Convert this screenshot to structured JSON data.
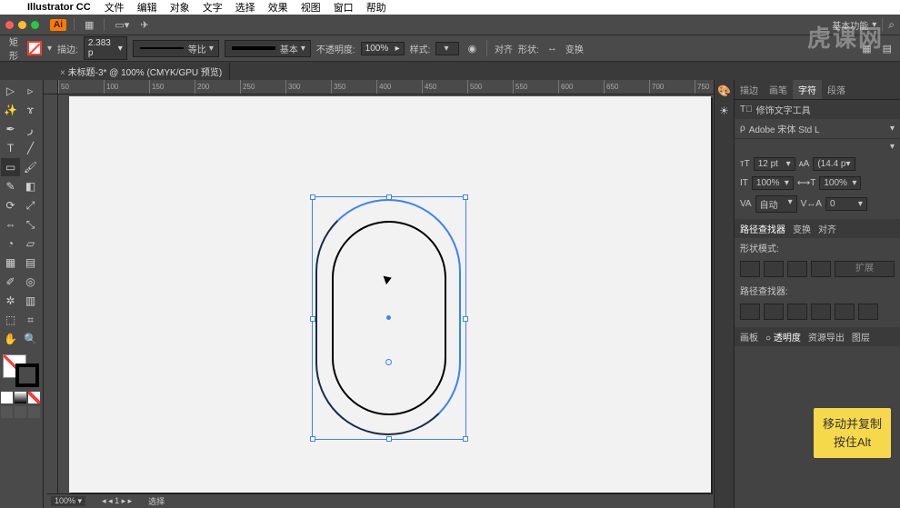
{
  "mac_menu": {
    "app_name": "Illustrator CC",
    "items": [
      "文件",
      "编辑",
      "对象",
      "文字",
      "选择",
      "效果",
      "视图",
      "窗口",
      "帮助"
    ]
  },
  "chrome": {
    "essentials_label": "基本功能",
    "search_icon": "search-icon"
  },
  "control_bar": {
    "tool_label": "矩形",
    "stroke_label": "描边:",
    "stroke_weight": "2.383 p",
    "stroke_profile": "等比",
    "brush_def": "基本",
    "opacity_label": "不透明度:",
    "opacity_value": "100%",
    "style_label": "样式:",
    "align_label": "对齐",
    "shape_label": "形状:",
    "transform_label": "变换"
  },
  "doc_tab": {
    "label": "未标题-3* @ 100% (CMYK/GPU 预览)"
  },
  "ruler_ticks": [
    "50",
    "100",
    "150",
    "200",
    "250",
    "300",
    "350",
    "400",
    "450",
    "500",
    "550",
    "600",
    "650",
    "700",
    "750"
  ],
  "right_panels": {
    "tabs1": [
      "描边",
      "画笔",
      "字符",
      "段落"
    ],
    "touchup_label": "修饰文字工具",
    "font_name": "Adobe 宋体 Std L",
    "char": {
      "size_value": "12 pt",
      "leading_value": "(14.4 p",
      "hscale": "100%",
      "vscale": "100%",
      "tracking": "0",
      "kerning_option": "自动"
    },
    "tabs_pf": [
      "路径查找器",
      "变换",
      "对齐"
    ],
    "shape_mode_label": "形状模式:",
    "expand_label": "扩展",
    "pathfinder_label": "路径查找器:",
    "tabs_layers": [
      "画板",
      "○ 透明度",
      "资源导出",
      "图层"
    ]
  },
  "status": {
    "zoom": "100%",
    "tool_hint": "选择"
  },
  "tooltip": {
    "line1": "移动并复制",
    "line2": "按住Alt"
  },
  "watermark": "虎课网"
}
